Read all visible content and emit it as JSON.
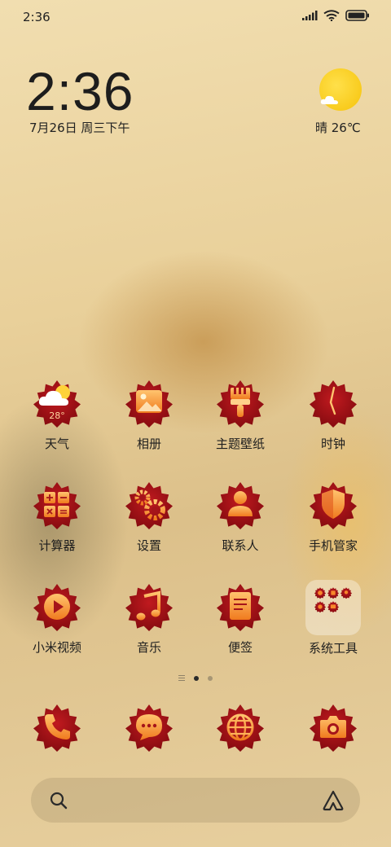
{
  "status_bar": {
    "time": "2:36",
    "icons": [
      "signal-icon",
      "wifi-icon",
      "battery-icon"
    ]
  },
  "clock": {
    "time": "2:36",
    "date": "7月26日 周三下午"
  },
  "weather": {
    "text": "晴 26℃",
    "icon": "sun-cloud-icon"
  },
  "apps": [
    {
      "name": "weather",
      "label": "天气",
      "icon": "weather-icon",
      "badge": "28°"
    },
    {
      "name": "gallery",
      "label": "相册",
      "icon": "gallery-icon"
    },
    {
      "name": "themes",
      "label": "主题壁纸",
      "icon": "brush-icon"
    },
    {
      "name": "clock",
      "label": "时钟",
      "icon": "clock-icon"
    },
    {
      "name": "calculator",
      "label": "计算器",
      "icon": "calculator-icon"
    },
    {
      "name": "settings",
      "label": "设置",
      "icon": "gear-icon"
    },
    {
      "name": "contacts",
      "label": "联系人",
      "icon": "person-icon"
    },
    {
      "name": "security",
      "label": "手机管家",
      "icon": "shield-icon"
    },
    {
      "name": "video",
      "label": "小米视频",
      "icon": "play-icon"
    },
    {
      "name": "music",
      "label": "音乐",
      "icon": "music-note-icon"
    },
    {
      "name": "notes",
      "label": "便签",
      "icon": "note-icon"
    },
    {
      "name": "tools-folder",
      "label": "系统工具",
      "icon": "folder-icon"
    }
  ],
  "dock": [
    {
      "name": "phone",
      "icon": "phone-icon"
    },
    {
      "name": "messages",
      "icon": "chat-icon"
    },
    {
      "name": "browser",
      "icon": "globe-icon"
    },
    {
      "name": "camera",
      "icon": "camera-icon"
    }
  ],
  "pages": {
    "count": 2,
    "current": 1
  },
  "search": {
    "left_icon": "search-icon",
    "right_icon": "assistant-icon"
  },
  "colors": {
    "badge_red": "#b0131a",
    "badge_dark": "#7e0a10",
    "glyph_orange": "#f7882a",
    "glyph_light": "#ffd08a"
  }
}
